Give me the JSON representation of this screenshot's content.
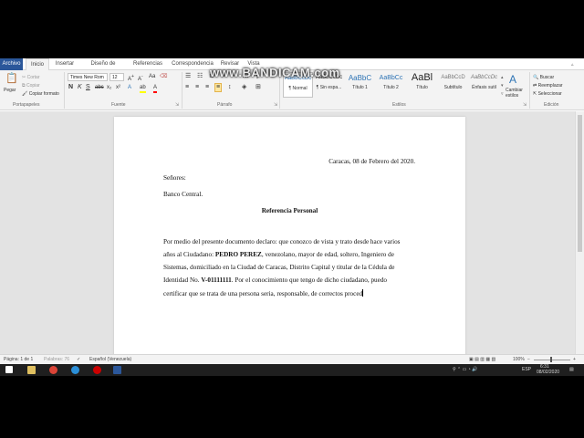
{
  "watermark": "www.BANDICAM.com",
  "ribbon_tabs": [
    "Archivo",
    "Inicio",
    "Insertar",
    "Diseño de página",
    "Referencias",
    "Correspondencia",
    "Revisar",
    "Vista"
  ],
  "clipboard": {
    "paste": "Pegar",
    "cut": "Cortar",
    "copy": "Copiar",
    "format_painter": "Copiar formato",
    "group": "Portapapeles"
  },
  "font": {
    "name": "Times New Rom",
    "size": "12",
    "group": "Fuente"
  },
  "paragraph": {
    "group": "Párrafo"
  },
  "styles": {
    "group": "Estilos",
    "items": [
      {
        "preview": "AaBbCcDc",
        "name": "¶ Normal"
      },
      {
        "preview": "AaBbCcDc",
        "name": "¶ Sin espa..."
      },
      {
        "preview": "AaBbC",
        "name": "Título 1"
      },
      {
        "preview": "AaBbCc",
        "name": "Título 2"
      },
      {
        "preview": "AaBl",
        "name": "Título"
      },
      {
        "preview": "AaBbCcD",
        "name": "Subtítulo"
      },
      {
        "preview": "AaBbCcDc",
        "name": "Énfasis sutil"
      }
    ],
    "change": "Cambiar estilos"
  },
  "editing": {
    "group": "Edición",
    "find": "Buscar",
    "replace": "Reemplazar",
    "select": "Seleccionar"
  },
  "document": {
    "date": "Caracas, 08 de Febrero del 2020.",
    "salutation": "Señores:",
    "recipient": "Banco Central.",
    "title": "Referencia Personal",
    "line1": "Por medio del presente documento declaro: que conozco de vista y trato desde hace varios",
    "line2_a": "años al Ciudadano: ",
    "line2_b": "PEDRO PEREZ",
    "line2_c": ", venezolano, mayor de edad, soltero, Ingeniero de",
    "line3": "Sistemas, domiciliado en la Ciudad de Caracas, Distrito Capital y titular de la Cédula de",
    "line4_a": "Identidad No. ",
    "line4_b": "V-01111111",
    "line4_c": ".  Por el conocimiento que tengo de dicho ciudadano, puedo",
    "line5": "certificar que se trata de una persona seria, responsable, de correctos proced"
  },
  "status": {
    "page": "Página: 1 de 1",
    "words": "Palabras: 76",
    "language": "Español (Venezuela)",
    "zoom": "100%"
  },
  "taskbar": {
    "lang": "ESP",
    "time": "6:31",
    "date": "08/02/2020"
  },
  "colors": {
    "accent": "#2b579a",
    "highlight": "#ffff00",
    "font_color": "#ff0000"
  }
}
